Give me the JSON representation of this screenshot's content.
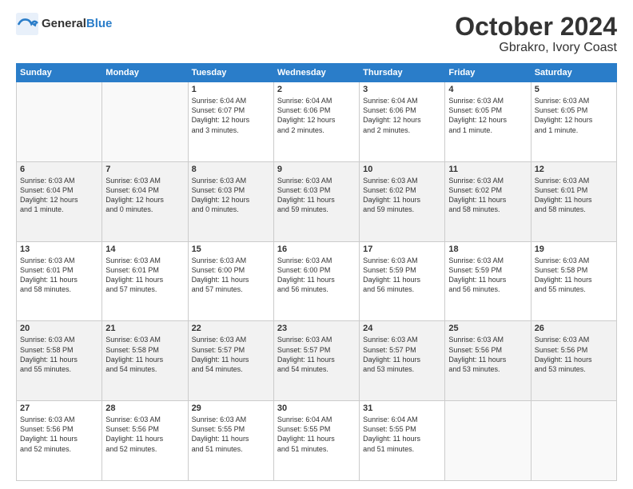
{
  "header": {
    "logo_general": "General",
    "logo_blue": "Blue",
    "title": "October 2024",
    "subtitle": "Gbrakro, Ivory Coast"
  },
  "calendar": {
    "days_of_week": [
      "Sunday",
      "Monday",
      "Tuesday",
      "Wednesday",
      "Thursday",
      "Friday",
      "Saturday"
    ],
    "weeks": [
      [
        {
          "day": "",
          "info": ""
        },
        {
          "day": "",
          "info": ""
        },
        {
          "day": "1",
          "info": "Sunrise: 6:04 AM\nSunset: 6:07 PM\nDaylight: 12 hours\nand 3 minutes."
        },
        {
          "day": "2",
          "info": "Sunrise: 6:04 AM\nSunset: 6:06 PM\nDaylight: 12 hours\nand 2 minutes."
        },
        {
          "day": "3",
          "info": "Sunrise: 6:04 AM\nSunset: 6:06 PM\nDaylight: 12 hours\nand 2 minutes."
        },
        {
          "day": "4",
          "info": "Sunrise: 6:03 AM\nSunset: 6:05 PM\nDaylight: 12 hours\nand 1 minute."
        },
        {
          "day": "5",
          "info": "Sunrise: 6:03 AM\nSunset: 6:05 PM\nDaylight: 12 hours\nand 1 minute."
        }
      ],
      [
        {
          "day": "6",
          "info": "Sunrise: 6:03 AM\nSunset: 6:04 PM\nDaylight: 12 hours\nand 1 minute."
        },
        {
          "day": "7",
          "info": "Sunrise: 6:03 AM\nSunset: 6:04 PM\nDaylight: 12 hours\nand 0 minutes."
        },
        {
          "day": "8",
          "info": "Sunrise: 6:03 AM\nSunset: 6:03 PM\nDaylight: 12 hours\nand 0 minutes."
        },
        {
          "day": "9",
          "info": "Sunrise: 6:03 AM\nSunset: 6:03 PM\nDaylight: 11 hours\nand 59 minutes."
        },
        {
          "day": "10",
          "info": "Sunrise: 6:03 AM\nSunset: 6:02 PM\nDaylight: 11 hours\nand 59 minutes."
        },
        {
          "day": "11",
          "info": "Sunrise: 6:03 AM\nSunset: 6:02 PM\nDaylight: 11 hours\nand 58 minutes."
        },
        {
          "day": "12",
          "info": "Sunrise: 6:03 AM\nSunset: 6:01 PM\nDaylight: 11 hours\nand 58 minutes."
        }
      ],
      [
        {
          "day": "13",
          "info": "Sunrise: 6:03 AM\nSunset: 6:01 PM\nDaylight: 11 hours\nand 58 minutes."
        },
        {
          "day": "14",
          "info": "Sunrise: 6:03 AM\nSunset: 6:01 PM\nDaylight: 11 hours\nand 57 minutes."
        },
        {
          "day": "15",
          "info": "Sunrise: 6:03 AM\nSunset: 6:00 PM\nDaylight: 11 hours\nand 57 minutes."
        },
        {
          "day": "16",
          "info": "Sunrise: 6:03 AM\nSunset: 6:00 PM\nDaylight: 11 hours\nand 56 minutes."
        },
        {
          "day": "17",
          "info": "Sunrise: 6:03 AM\nSunset: 5:59 PM\nDaylight: 11 hours\nand 56 minutes."
        },
        {
          "day": "18",
          "info": "Sunrise: 6:03 AM\nSunset: 5:59 PM\nDaylight: 11 hours\nand 56 minutes."
        },
        {
          "day": "19",
          "info": "Sunrise: 6:03 AM\nSunset: 5:58 PM\nDaylight: 11 hours\nand 55 minutes."
        }
      ],
      [
        {
          "day": "20",
          "info": "Sunrise: 6:03 AM\nSunset: 5:58 PM\nDaylight: 11 hours\nand 55 minutes."
        },
        {
          "day": "21",
          "info": "Sunrise: 6:03 AM\nSunset: 5:58 PM\nDaylight: 11 hours\nand 54 minutes."
        },
        {
          "day": "22",
          "info": "Sunrise: 6:03 AM\nSunset: 5:57 PM\nDaylight: 11 hours\nand 54 minutes."
        },
        {
          "day": "23",
          "info": "Sunrise: 6:03 AM\nSunset: 5:57 PM\nDaylight: 11 hours\nand 54 minutes."
        },
        {
          "day": "24",
          "info": "Sunrise: 6:03 AM\nSunset: 5:57 PM\nDaylight: 11 hours\nand 53 minutes."
        },
        {
          "day": "25",
          "info": "Sunrise: 6:03 AM\nSunset: 5:56 PM\nDaylight: 11 hours\nand 53 minutes."
        },
        {
          "day": "26",
          "info": "Sunrise: 6:03 AM\nSunset: 5:56 PM\nDaylight: 11 hours\nand 53 minutes."
        }
      ],
      [
        {
          "day": "27",
          "info": "Sunrise: 6:03 AM\nSunset: 5:56 PM\nDaylight: 11 hours\nand 52 minutes."
        },
        {
          "day": "28",
          "info": "Sunrise: 6:03 AM\nSunset: 5:56 PM\nDaylight: 11 hours\nand 52 minutes."
        },
        {
          "day": "29",
          "info": "Sunrise: 6:03 AM\nSunset: 5:55 PM\nDaylight: 11 hours\nand 51 minutes."
        },
        {
          "day": "30",
          "info": "Sunrise: 6:04 AM\nSunset: 5:55 PM\nDaylight: 11 hours\nand 51 minutes."
        },
        {
          "day": "31",
          "info": "Sunrise: 6:04 AM\nSunset: 5:55 PM\nDaylight: 11 hours\nand 51 minutes."
        },
        {
          "day": "",
          "info": ""
        },
        {
          "day": "",
          "info": ""
        }
      ]
    ]
  }
}
